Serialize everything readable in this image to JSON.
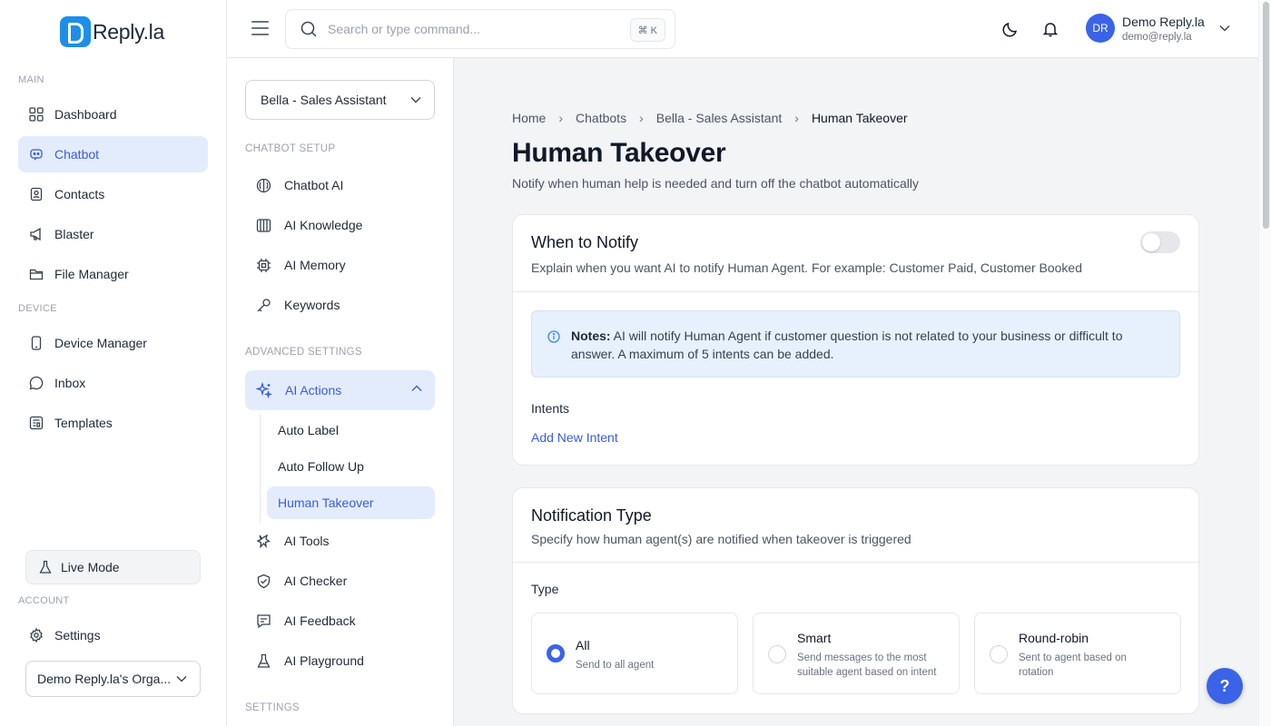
{
  "brand": {
    "name": "Reply.la"
  },
  "sidebar": {
    "section_main": "MAIN",
    "section_device": "DEVICE",
    "section_account": "ACCOUNT",
    "items": [
      {
        "label": "Dashboard",
        "icon": "grid-icon"
      },
      {
        "label": "Chatbot",
        "icon": "chatbot-icon"
      },
      {
        "label": "Contacts",
        "icon": "contacts-icon"
      },
      {
        "label": "Blaster",
        "icon": "megaphone-icon"
      },
      {
        "label": "File Manager",
        "icon": "folder-icon"
      },
      {
        "label": "Device Manager",
        "icon": "phone-icon"
      },
      {
        "label": "Inbox",
        "icon": "message-icon"
      },
      {
        "label": "Templates",
        "icon": "template-icon"
      }
    ],
    "live_mode": "Live Mode",
    "settings": "Settings",
    "org_select": "Demo Reply.la's Orga..."
  },
  "topbar": {
    "search_placeholder": "Search or type command...",
    "shortcut": "⌘ K",
    "user_initials": "DR",
    "user_name": "Demo Reply.la",
    "user_email": "demo@reply.la"
  },
  "subnav": {
    "bot_select": "Bella - Sales Assistant",
    "section_setup": "CHATBOT SETUP",
    "section_advanced": "ADVANCED SETTINGS",
    "section_settings": "SETTINGS",
    "setup_items": [
      "Chatbot AI",
      "AI Knowledge",
      "AI Memory",
      "Keywords"
    ],
    "ai_actions": "AI Actions",
    "ai_action_children": [
      "Auto Label",
      "Auto Follow Up",
      "Human Takeover"
    ],
    "advanced_items": [
      "AI Tools",
      "AI Checker",
      "AI Feedback",
      "AI Playground"
    ]
  },
  "main": {
    "breadcrumb": [
      "Home",
      "Chatbots",
      "Bella - Sales Assistant",
      "Human Takeover"
    ],
    "title": "Human Takeover",
    "subtitle": "Notify when human help is needed and turn off the chatbot automatically",
    "notify_card": {
      "title": "When to Notify",
      "description": "Explain when you want AI to notify Human Agent. For example: Customer Paid, Customer Booked",
      "toggle_on": false,
      "notes_label": "Notes:",
      "notes_text": " AI will notify Human Agent if customer question is not related to your business or difficult to answer. A maximum of 5 intents can be added.",
      "intents_label": "Intents",
      "add_intent": "Add New Intent"
    },
    "type_card": {
      "title": "Notification Type",
      "description": "Specify how human agent(s) are notified when takeover is triggered",
      "type_label": "Type",
      "options": [
        {
          "title": "All",
          "desc": "Send to all agent",
          "selected": true
        },
        {
          "title": "Smart",
          "desc": "Send messages to the most suitable agent based on intent",
          "selected": false
        },
        {
          "title": "Round-robin",
          "desc": "Sent to agent based on rotation",
          "selected": false
        }
      ]
    }
  },
  "help": "?",
  "colors": {
    "accent": "#3b5bdb",
    "active_bg": "#e3ecfd",
    "brand_blue": "#1d8fe8"
  }
}
